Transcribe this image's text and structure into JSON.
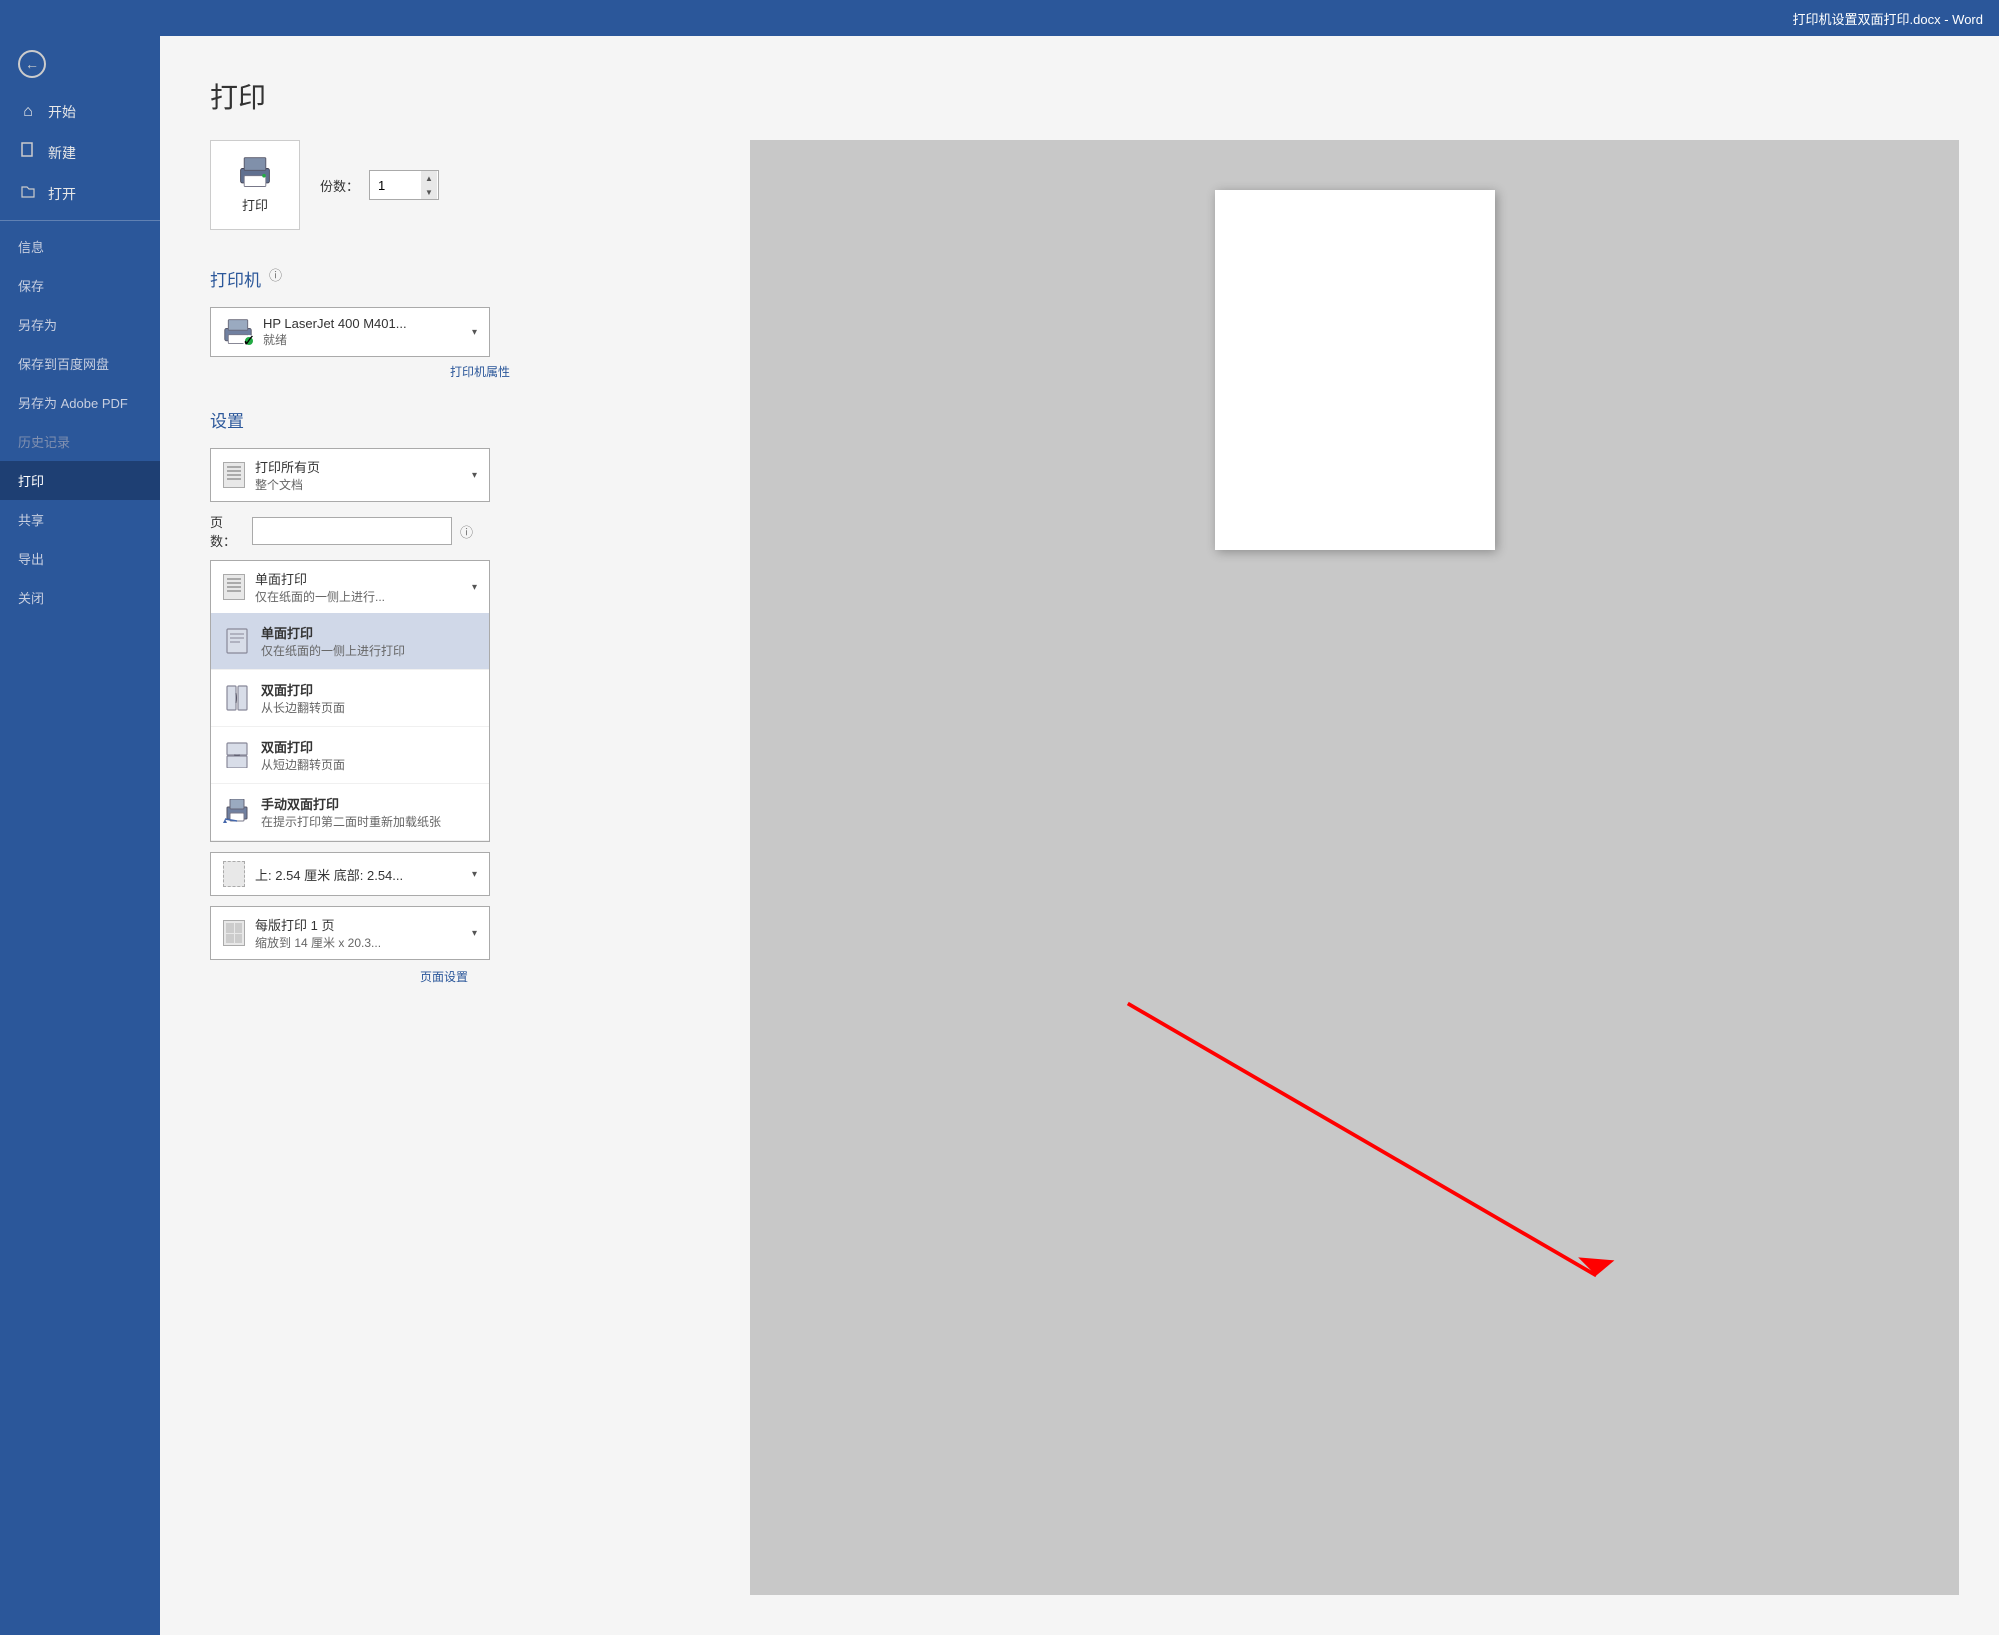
{
  "titlebar": {
    "text": "打印机设置双面打印.docx  -  Word"
  },
  "sidebar": {
    "back_label": "←",
    "items": [
      {
        "id": "home",
        "icon": "⌂",
        "label": "开始"
      },
      {
        "id": "new",
        "icon": "□",
        "label": "新建"
      },
      {
        "id": "open",
        "icon": "📂",
        "label": "打开"
      }
    ],
    "divider": true,
    "text_items": [
      {
        "id": "info",
        "label": "信息"
      },
      {
        "id": "save",
        "label": "保存"
      },
      {
        "id": "save-as",
        "label": "另存为"
      },
      {
        "id": "save-baidu",
        "label": "保存到百度网盘"
      },
      {
        "id": "save-pdf",
        "label": "另存为 Adobe PDF"
      },
      {
        "id": "history",
        "label": "历史记录"
      },
      {
        "id": "print",
        "label": "打印",
        "active": true
      },
      {
        "id": "share",
        "label": "共享"
      },
      {
        "id": "export",
        "label": "导出"
      },
      {
        "id": "close",
        "label": "关闭"
      }
    ]
  },
  "main": {
    "title": "打印",
    "print_button": "打印",
    "copies_label": "份数：",
    "copies_value": "1"
  },
  "printer_section": {
    "title": "打印机",
    "name": "HP LaserJet 400 M401...",
    "status": "就绪",
    "properties_link": "打印机属性"
  },
  "settings_section": {
    "title": "设置",
    "page_range_main": "打印所有页",
    "page_range_sub": "整个文档",
    "pages_label": "页数：",
    "pages_value": "",
    "sides_current_main": "单面打印",
    "sides_current_sub": "仅在纸面的一侧上进行...",
    "menu_items": [
      {
        "id": "single",
        "title": "单面打印",
        "sub": "仅在纸面的一侧上进行打印",
        "selected": true
      },
      {
        "id": "duplex-long",
        "title": "双面打印",
        "sub": "从长边翻转页面"
      },
      {
        "id": "duplex-short",
        "title": "双面打印",
        "sub": "从短边翻转页面"
      },
      {
        "id": "manual-duplex",
        "title": "手动双面打印",
        "sub": "在提示打印第二面时重新加载纸张"
      }
    ],
    "margins_main": "上: 2.54 厘米 底部: 2.54...",
    "margins_sub": "",
    "pages_per_sheet_main": "每版打印 1 页",
    "pages_per_sheet_sub": "缩放到 14 厘米 x 20.3...",
    "page_setup_link": "页面设置"
  }
}
